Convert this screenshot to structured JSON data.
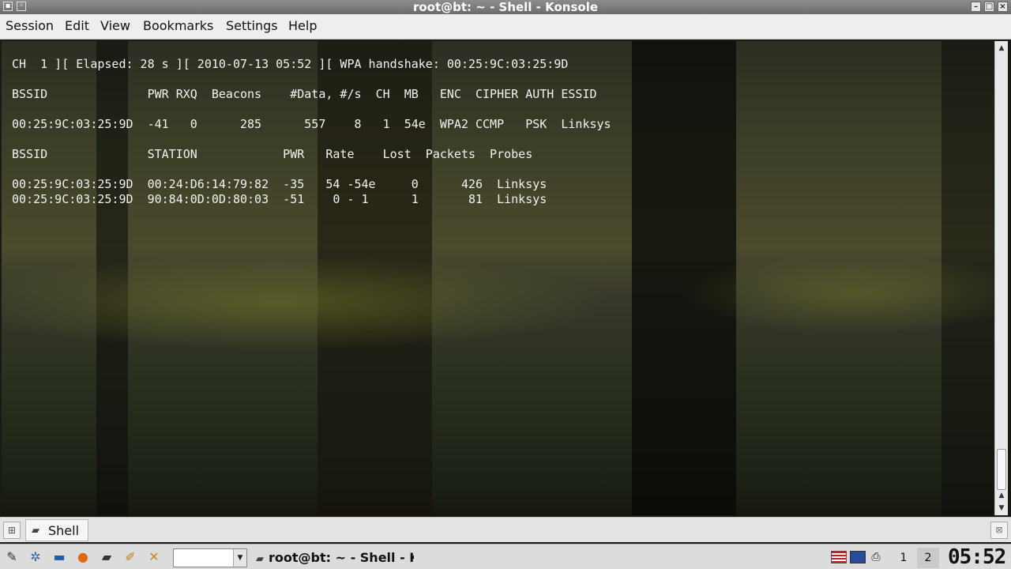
{
  "window": {
    "title": "root@bt: ~ - Shell - Konsole",
    "buttons": [
      "minimize",
      "maximize",
      "close"
    ]
  },
  "menubar": {
    "items": [
      "Session",
      "Edit",
      "View",
      "Bookmarks",
      "Settings",
      "Help"
    ]
  },
  "terminal": {
    "lines": [
      "CH  1 ][ Elapsed: 28 s ][ 2010-07-13 05:52 ][ WPA handshake: 00:25:9C:03:25:9D",
      "",
      "BSSID              PWR RXQ  Beacons    #Data, #/s  CH  MB   ENC  CIPHER AUTH ESSID",
      "",
      "00:25:9C:03:25:9D  -41   0      285      557    8   1  54e  WPA2 CCMP   PSK  Linksys",
      "",
      "BSSID              STATION            PWR   Rate    Lost  Packets  Probes",
      "",
      "00:25:9C:03:25:9D  00:24:D6:14:79:82  -35   54 -54e     0      426  Linksys",
      "00:25:9C:03:25:9D  90:84:0D:0D:80:03  -51    0 - 1      1       81  Linksys"
    ]
  },
  "tabbar": {
    "tabs": [
      {
        "label": "Shell",
        "icon": "terminal-icon"
      }
    ]
  },
  "taskbar": {
    "quick_launch": [
      "kde-menu-icon",
      "network-icon",
      "desktop-icon",
      "firefox-icon",
      "terminal-icon",
      "ruler-icon",
      "crosshair-icon"
    ],
    "task_label": "root@bt: ~ - Shell - Konsole",
    "desktops": [
      "1",
      "2"
    ],
    "clock": "05:52",
    "tray": [
      "us-flag-icon",
      "network-tray-icon",
      "klipper-icon"
    ]
  }
}
